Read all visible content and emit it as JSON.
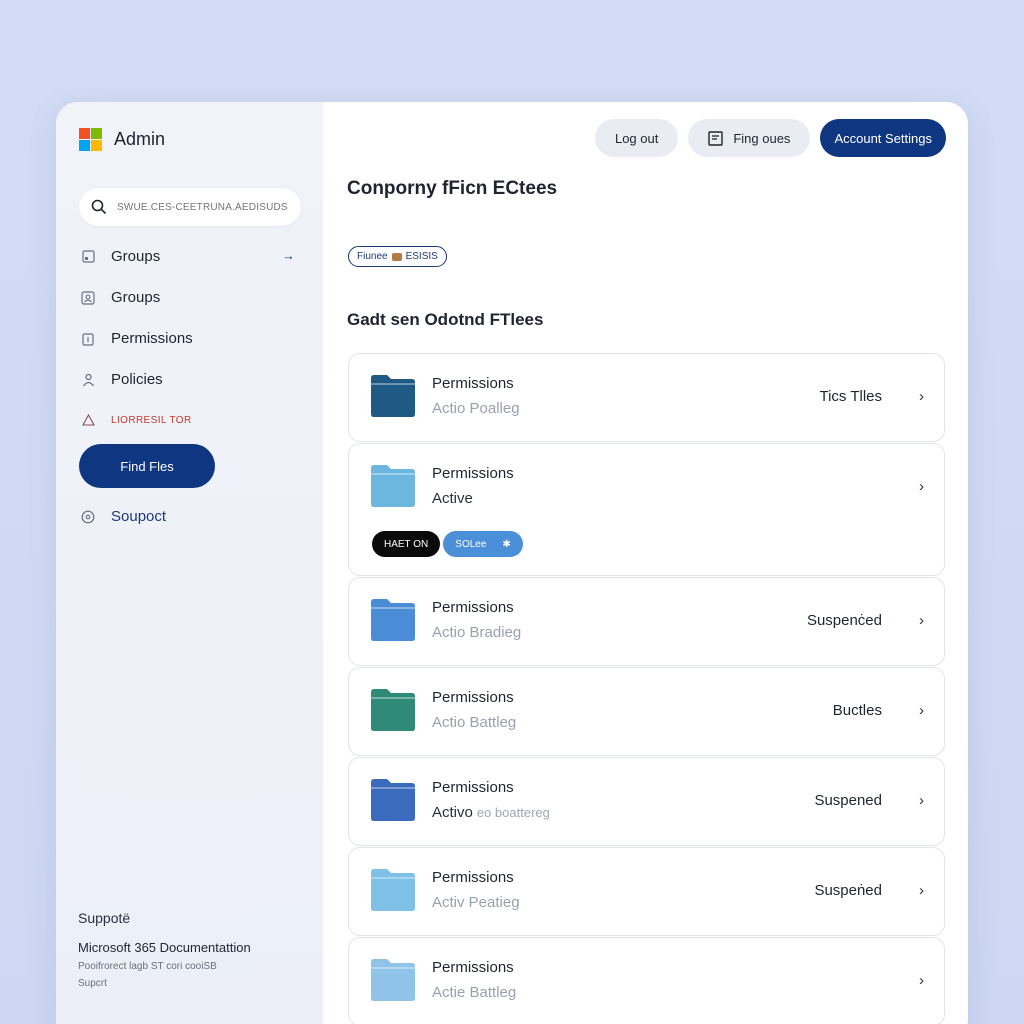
{
  "app": {
    "title": "Admin"
  },
  "colors": {
    "accent": "#0f3680",
    "ms_red": "#f25022",
    "ms_green": "#7fba00",
    "ms_blue": "#00a4ef",
    "ms_yellow": "#ffb900"
  },
  "sidebar": {
    "search_placeholder": "SWUE.CES-CEETRUNA.AEDISUDS",
    "items": [
      {
        "label": "Groups",
        "icon": "group-icon"
      },
      {
        "label": "Groups",
        "icon": "user-group-icon"
      },
      {
        "label": "Permissions",
        "icon": "lock-icon"
      },
      {
        "label": "Policies",
        "icon": "person-icon"
      },
      {
        "label": "LIORRESIL TOR",
        "icon": "warning-icon"
      },
      {
        "label": "Soupoct",
        "icon": "help-icon"
      }
    ],
    "find_files_label": "Find Fles",
    "footer": {
      "heading": "Suppotë",
      "doc": "Microsoft 365 Documentattion",
      "line1": "Pooifrorect lagb ST cori cooiSB",
      "line2": "Supcrt"
    }
  },
  "topbar": {
    "logout_label": "Log out",
    "find_label": "Fing oues",
    "account_label": "Account Settings"
  },
  "main": {
    "title": "Conporny fFicn ECtees",
    "tag_label": "Fiunee",
    "tag_suffix": "ESISIS",
    "section_title": "Gadt sen Odotnd FTlees",
    "rows": [
      {
        "name": "Permissions",
        "sub": "Actio Poalleg",
        "status": "Tics Tlles",
        "color": "#1f5a85"
      },
      {
        "name": "Permissions",
        "sub": "Active",
        "status": "",
        "color": "#6cb6e0",
        "badges": [
          "HAET ON",
          "SOLee"
        ]
      },
      {
        "name": "Permissions",
        "sub": "Actio Bradieg",
        "status": "Suspenċed",
        "color": "#4a8dd6"
      },
      {
        "name": "Permissions",
        "sub": "Actio Battleg",
        "status": "Buctles",
        "color": "#2f8a78"
      },
      {
        "name": "Permissions",
        "sub": "Activo",
        "sub_extra": "eo boattereg",
        "status": "Suspened",
        "color": "#3a6bbd"
      },
      {
        "name": "Permissions",
        "sub": "Activ Peatieg",
        "status": "Suspeṅed",
        "color": "#7ec0e6"
      },
      {
        "name": "Permissions",
        "sub": "Actie Battleg",
        "status": "",
        "color": "#8fc3e8"
      }
    ]
  }
}
